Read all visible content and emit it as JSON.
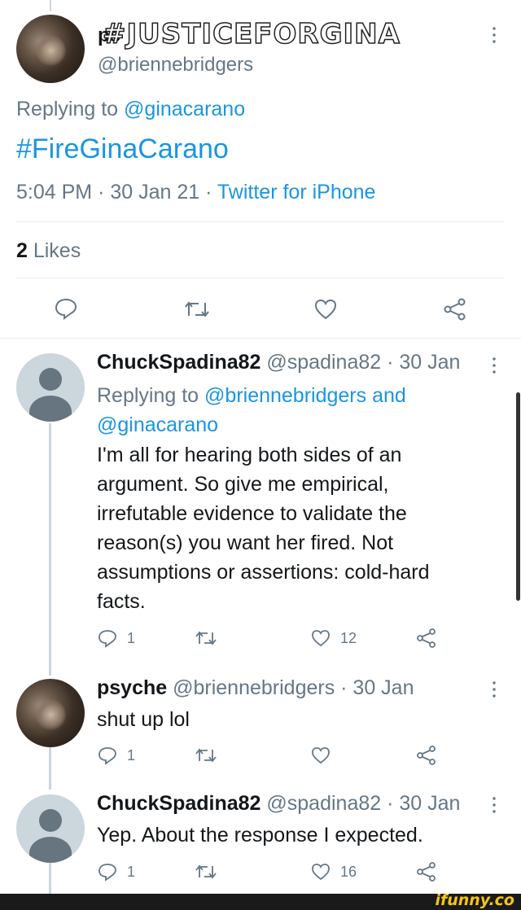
{
  "main_tweet": {
    "name_overlay": "#JUSTICEFORGINA",
    "name_partial": "ps",
    "handle": "@briennebridgers",
    "replying_prefix": "Replying to ",
    "replying_handle": "@ginacarano",
    "text": "#FireGinaCarano",
    "time": "5:04 PM · 30 Jan 21 · ",
    "source": "Twitter for iPhone",
    "likes_count": "2",
    "likes_label": " Likes"
  },
  "replies": [
    {
      "name": "ChuckSpadina82",
      "handle_date": " @spadina82 · 30 Jan",
      "replying_prefix": "Replying to ",
      "replying_handle_line1": "@briennebridgers and",
      "replying_handle_line2": "@ginacarano",
      "text_lines": [
        "I'm all for hearing both sides of an",
        "argument. So give me empirical,",
        "irrefutable evidence to validate the",
        "reason(s) you want her fired. Not",
        "assumptions or assertions: cold-hard",
        "facts."
      ],
      "reply_count": "1",
      "retweet_count": "",
      "like_count": "12"
    },
    {
      "name": "psyche",
      "handle_date": " @briennebridgers · 30 Jan",
      "text_lines": [
        "shut up lol"
      ],
      "reply_count": "1",
      "retweet_count": "",
      "like_count": ""
    },
    {
      "name": "ChuckSpadina82",
      "handle_date": " @spadina82 · 30 Jan",
      "text_lines": [
        "Yep. About the response I expected."
      ],
      "reply_count": "1",
      "retweet_count": "",
      "like_count": "16"
    }
  ],
  "watermark": "ifunny.co",
  "colors": {
    "link": "#1b95e0",
    "secondary": "#657786",
    "divider": "#e6ecf0",
    "watermark": "#f5c518"
  },
  "icons": [
    "reply-icon",
    "retweet-icon",
    "like-icon",
    "share-icon",
    "more-icon"
  ]
}
